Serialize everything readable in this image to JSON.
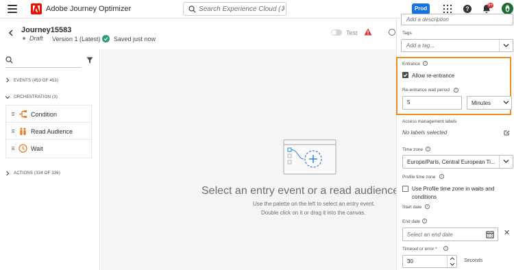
{
  "app": {
    "title": "Adobe Journey Optimizer"
  },
  "search": {
    "placeholder": "Search Experience Cloud (⌘+/)"
  },
  "header": {
    "env_label": "Prod",
    "notification_count": "9+"
  },
  "journey": {
    "name": "Journey15583",
    "status": "Draft",
    "version": "Version 1 (Latest)",
    "saved": "Saved just now",
    "test_label": "Test"
  },
  "palette": {
    "events_label": "EVENTS (453 OF 453)",
    "orchestration_label": "ORCHESTRATION (3)",
    "orchestration_items": [
      {
        "label": "Condition",
        "icon": "condition-icon"
      },
      {
        "label": "Read Audience",
        "icon": "read-audience-icon"
      },
      {
        "label": "Wait",
        "icon": "wait-icon"
      }
    ],
    "actions_label": "ACTIONS (334 OF 336)"
  },
  "canvas": {
    "title": "Select an entry event or a read audience ac",
    "hint_line1": "Use the palette on the left to select an entry event.",
    "hint_line2": "Double click on it or drag it into the canvas."
  },
  "properties": {
    "description_placeholder": "Add a description",
    "tags_label": "Tags",
    "tags_placeholder": "Add a tag...",
    "entrance_label": "Entrance",
    "allow_reentrance_label": "Allow re-entrance",
    "allow_reentrance_checked": true,
    "reentrance_wait_label": "Re-entrance wait period",
    "reentrance_wait_value": "5",
    "reentrance_wait_unit": "Minutes",
    "access_label": "Access management labels",
    "access_value": "No labels selected",
    "timezone_label": "Time zone",
    "timezone_value": "Europe/Paris, Central European Ti...",
    "profile_tz_label": "Profile time zone",
    "profile_tz_checkbox_label": "Use Profile time zone in waits and conditions",
    "profile_tz_checked": false,
    "start_date_label": "Start date",
    "end_date_label": "End date",
    "end_date_placeholder": "Select an end date",
    "timeout_label": "Timeout or error",
    "timeout_required_mark": "*",
    "timeout_value": "30",
    "timeout_unit": "Seconds"
  },
  "colors": {
    "brand": "#eb1000",
    "accent": "#1473e6",
    "highlight": "#f08a24",
    "success": "#2d9d78",
    "warning": "#d7373f"
  }
}
